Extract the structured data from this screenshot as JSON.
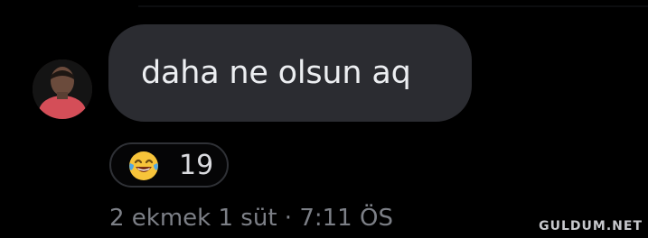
{
  "message": {
    "text": "daha ne olsun aq"
  },
  "reaction": {
    "icon": "laughing-with-tears-emoji",
    "count": "19"
  },
  "meta": {
    "text": "2 ekmek 1 süt · 7:11 ÖS"
  },
  "watermark": {
    "text": "GULDUM.NET"
  },
  "colors": {
    "background": "#000000",
    "bubble": "#2b2c31",
    "bubble_text": "#eceef1",
    "meta_text": "#7c7f86"
  }
}
